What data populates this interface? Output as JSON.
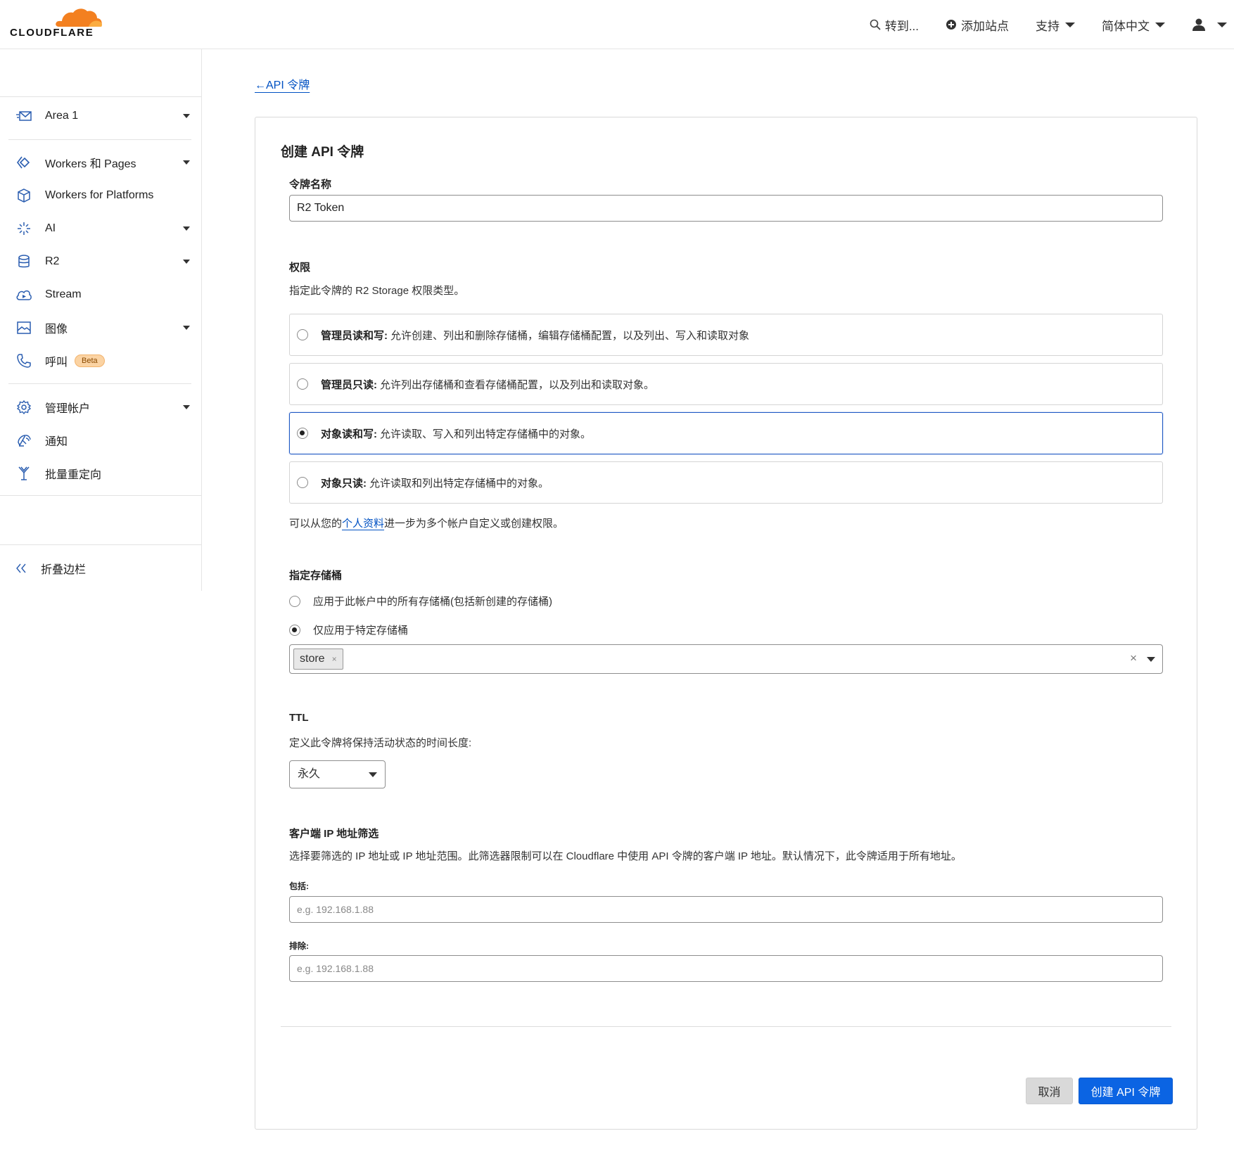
{
  "header": {
    "logo_text": "CLOUDFLARE",
    "goto_label": "转到...",
    "add_site_label": "添加站点",
    "support_label": "支持",
    "language_label": "简体中文"
  },
  "sidebar": {
    "items": [
      {
        "label": "Area 1",
        "icon": "mail-icon",
        "has_dropdown": true
      },
      {
        "label": "Workers 和 Pages",
        "icon": "workers-icon",
        "has_dropdown": true
      },
      {
        "label": "Workers for Platforms",
        "icon": "cube-icon",
        "has_dropdown": false
      },
      {
        "label": "AI",
        "icon": "sparkles-icon",
        "has_dropdown": true
      },
      {
        "label": "R2",
        "icon": "database-icon",
        "has_dropdown": true
      },
      {
        "label": "Stream",
        "icon": "cloud-play-icon",
        "has_dropdown": false
      },
      {
        "label": "图像",
        "icon": "image-icon",
        "has_dropdown": true
      },
      {
        "label": "呼叫",
        "icon": "phone-icon",
        "has_dropdown": false,
        "badge": "Beta"
      },
      {
        "label": "管理帐户",
        "icon": "gear-icon",
        "has_dropdown": true
      },
      {
        "label": "通知",
        "icon": "satellite-icon",
        "has_dropdown": false
      },
      {
        "label": "批量重定向",
        "icon": "redirect-icon",
        "has_dropdown": false
      }
    ],
    "collapse_label": "折叠边栏"
  },
  "main": {
    "back_link": "←API 令牌",
    "title": "创建 API 令牌",
    "token_name": {
      "label": "令牌名称",
      "value": "R2 Token"
    },
    "permissions": {
      "label": "权限",
      "description": "指定此令牌的 R2 Storage 权限类型。",
      "options": [
        {
          "title": "管理员读和写:",
          "desc": "允许创建、列出和删除存储桶，编辑存储桶配置，以及列出、写入和读取对象",
          "selected": false
        },
        {
          "title": "管理员只读:",
          "desc": "允许列出存储桶和查看存储桶配置，以及列出和读取对象。",
          "selected": false
        },
        {
          "title": "对象读和写:",
          "desc": "允许读取、写入和列出特定存储桶中的对象。",
          "selected": true
        },
        {
          "title": "对象只读:",
          "desc": "允许读取和列出特定存储桶中的对象。",
          "selected": false
        }
      ],
      "footnote_prefix": "可以从您的",
      "footnote_link": "个人资料",
      "footnote_suffix": "进一步为多个帐户自定义或创建权限。"
    },
    "buckets": {
      "label": "指定存储桶",
      "option_all": "应用于此帐户中的所有存储桶(包括新创建的存储桶)",
      "option_specific": "仅应用于特定存储桶",
      "selected_option": "specific",
      "chip": "store",
      "chip_remove": "×",
      "clear": "×"
    },
    "ttl": {
      "label": "TTL",
      "description": "定义此令牌将保持活动状态的时间长度:",
      "value": "永久"
    },
    "ip_filter": {
      "label": "客户端 IP 地址筛选",
      "description": "选择要筛选的 IP 地址或 IP 地址范围。此筛选器限制可以在 Cloudflare 中使用 API 令牌的客户端 IP 地址。默认情况下，此令牌适用于所有地址。",
      "include_label": "包括:",
      "include_placeholder": "e.g. 192.168.1.88",
      "exclude_label": "排除:",
      "exclude_placeholder": "e.g. 192.168.1.88"
    },
    "actions": {
      "cancel": "取消",
      "create": "创建 API 令牌"
    }
  },
  "colors": {
    "brand_orange": "#f38020",
    "link_blue": "#0051c3",
    "primary_button": "#0b64e3"
  }
}
